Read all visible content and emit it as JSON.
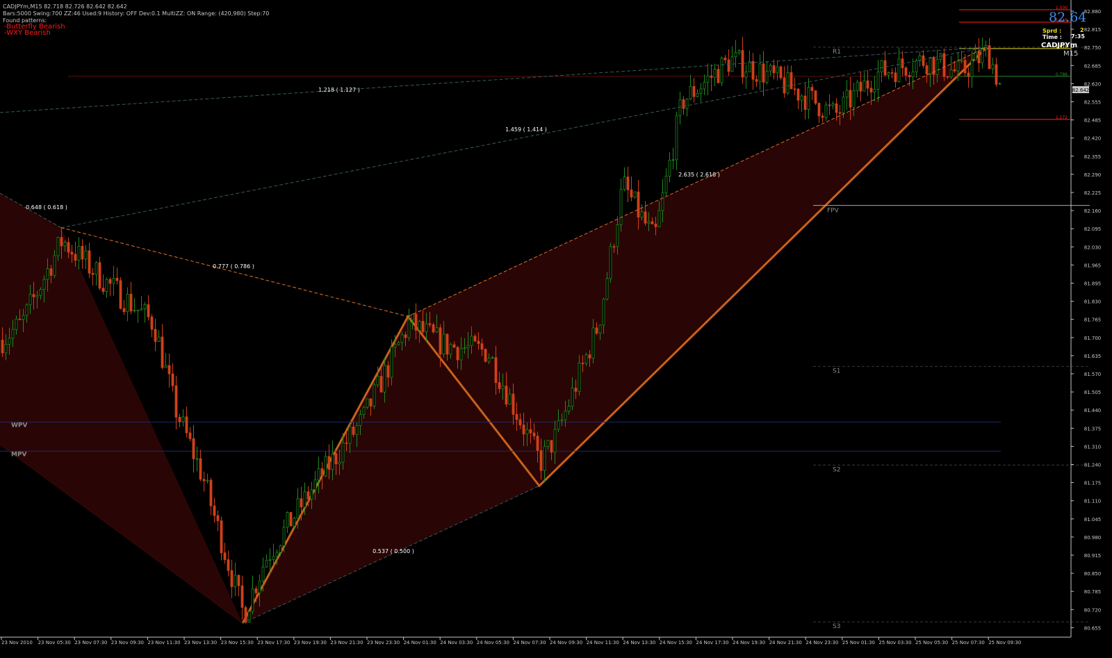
{
  "header": {
    "line1": "CADJPYm,M15  82.718 82.726 82.642 82.642",
    "line2": "Bars:5000  Swing:700  ZZ:46  Used:9  History: OFF Dev:0.1  MultiZZ: ON  Range: (420,980)  Step:70",
    "found_label": "Found patterns:",
    "patterns": [
      "-Butterfly Bearish",
      "-WXY Bearish"
    ]
  },
  "info_panel": {
    "price": "82.64",
    "spread_label": "Sprd :",
    "spread_value": "2",
    "time_label": "Time :",
    "time_value": "7:35",
    "symbol": "CADJPYm",
    "timeframe": "M15"
  },
  "fib_ratios": [
    {
      "text": "1.218 ( 1.127 )"
    },
    {
      "text": "1.459 ( 1.414 )"
    },
    {
      "text": "2.635 ( 2.618 )"
    },
    {
      "text": "0.648 ( 0.618 )"
    },
    {
      "text": "0.777 ( 0.786 )"
    },
    {
      "text": "0.537 ( 0.500 )"
    }
  ],
  "pivots": [
    {
      "label": "R1",
      "price": 82.795
    },
    {
      "label": "FPV",
      "price": 82.225
    },
    {
      "label": "S1",
      "price": 81.645
    },
    {
      "label": "WPV",
      "price": 81.445
    },
    {
      "label": "MPV",
      "price": 81.34
    },
    {
      "label": "S2",
      "price": 81.29
    },
    {
      "label": "S3",
      "price": 80.725
    }
  ],
  "target_levels": [
    {
      "label": "1.500",
      "price": 82.93
    },
    {
      "label": "1.618",
      "price": 82.885
    },
    {
      "label": "1.618",
      "price": 82.79
    },
    {
      "label": "0.786",
      "price": 82.69
    },
    {
      "label": "1.272",
      "price": 82.535
    }
  ],
  "price_axis": {
    "min": 80.655,
    "max": 82.945,
    "labels": [
      "82.880",
      "82.815",
      "82.750",
      "82.685",
      "82.620",
      "82.555",
      "82.485",
      "82.420",
      "82.355",
      "82.290",
      "82.225",
      "82.160",
      "82.095",
      "82.030",
      "81.965",
      "81.895",
      "81.830",
      "81.765",
      "81.700",
      "81.635",
      "81.570",
      "81.505",
      "81.440",
      "81.375",
      "81.310",
      "81.240",
      "81.175",
      "81.110",
      "81.045",
      "80.980",
      "80.915",
      "80.850",
      "80.785",
      "80.720",
      "80.655"
    ],
    "current": "82.642"
  },
  "time_axis": {
    "labels": [
      "23 Nov 2010",
      "23 Nov 05:30",
      "23 Nov 07:30",
      "23 Nov 09:30",
      "23 Nov 11:30",
      "23 Nov 13:30",
      "23 Nov 15:30",
      "23 Nov 17:30",
      "23 Nov 19:30",
      "23 Nov 21:30",
      "23 Nov 23:30",
      "24 Nov 01:30",
      "24 Nov 03:30",
      "24 Nov 05:30",
      "24 Nov 07:30",
      "24 Nov 09:30",
      "24 Nov 11:30",
      "24 Nov 13:30",
      "24 Nov 15:30",
      "24 Nov 17:30",
      "24 Nov 19:30",
      "24 Nov 21:30",
      "24 Nov 23:30",
      "25 Nov 01:30",
      "25 Nov 03:30",
      "25 Nov 05:30",
      "25 Nov 07:30",
      "25 Nov 09:30"
    ]
  },
  "pattern_points": {
    "X": 82.145,
    "A": 80.72,
    "B": 81.825,
    "C": 81.215,
    "D": 82.795
  },
  "colors": {
    "bull": "#1f8a1f",
    "bear": "#d0401a",
    "pattern_fill": "#2a0505",
    "pattern_line": "#c8621c",
    "fib_text": "#ffffff",
    "pivot_text": "#8a8a8a",
    "pivot_line": "#3a3a3a",
    "weekly_line": "#1c2a6a",
    "target_red": "#ff2020",
    "target_green": "#2a8a2a",
    "target_yellow": "#e8e020"
  }
}
